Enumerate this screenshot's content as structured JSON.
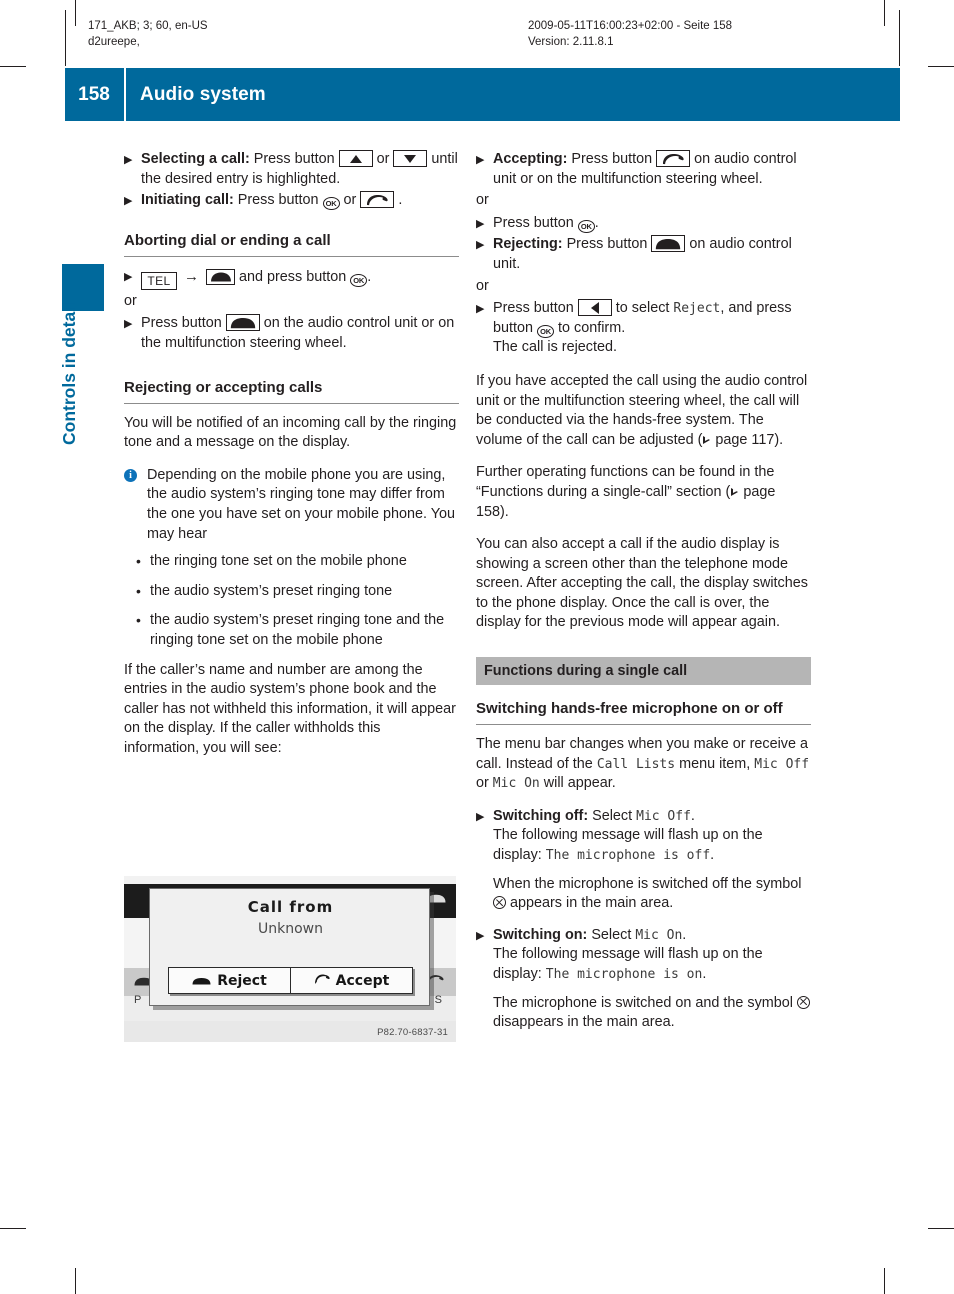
{
  "print_header": {
    "left_line1": "171_AKB; 3; 60, en-US",
    "left_line2": "d2ureepe,",
    "right_line1": "2009-05-11T16:00:23+02:00 - Seite 158",
    "right_line2": "Version: 2.11.8.1"
  },
  "banner": {
    "page_number": "158",
    "title": "Audio system",
    "color": "#00699c"
  },
  "thumb_tab": {
    "label": "Controls in detail",
    "color": "#00699c"
  },
  "left_column": {
    "step_selecting_prefix": "Selecting a call:",
    "step_selecting_text1": "Press button",
    "step_selecting_text2": "or",
    "step_selecting_text3": "until the desired entry is highlighted.",
    "step_initiating_prefix": "Initiating call:",
    "step_initiating_text1": "Press button",
    "step_initiating_text2": "or",
    "step_initiating_text3": ".",
    "heading_aborting": "Aborting dial or ending a call",
    "tel_label": "TEL",
    "step_tel_text": "and press button",
    "step_tel_period": ".",
    "or_label": "or",
    "step_press_text1": "Press button",
    "step_press_text2": "on the audio control unit or on the multifunction steering wheel.",
    "heading_rejecting": "Rejecting or accepting calls",
    "para_notified": "You will be notified of an incoming call by the ringing tone and a message on the display.",
    "note_text": "Depending on the mobile phone you are using, the audio system’s ringing tone may differ from the one you have set on your mobile phone. You may hear",
    "bullets": [
      "the ringing tone set on the mobile phone",
      "the audio system’s preset ringing tone",
      "the audio system’s preset ringing tone and the ringing tone set on the mobile phone"
    ],
    "para_caller": "If the caller’s name and number are among the entries in the audio system’s phone book and the caller has not withheld this information, it will appear on the display. If the caller withholds this information, you will see:"
  },
  "figure": {
    "dialog_title": "Call from",
    "dialog_subtitle": "Unknown",
    "button_reject": "Reject",
    "button_accept": "Accept",
    "menu_label_left": "P",
    "menu_label_right": "S",
    "caption": "P82.70-6837-31"
  },
  "right_column": {
    "step_accepting_prefix": "Accepting:",
    "step_accepting_text1": "Press button",
    "step_accepting_text2": "on audio control unit or on the multifunction steering wheel.",
    "or_label": "or",
    "step_press_ok_text1": "Press button",
    "step_press_ok_text2": ".",
    "step_rejecting_prefix": "Rejecting:",
    "step_rejecting_text1": "Press button",
    "step_rejecting_text2": "on audio control unit.",
    "step_select_text1": "Press button",
    "step_select_text2": "to select",
    "step_select_mono": "Reject",
    "step_select_text3": ", and press button",
    "step_select_text4": "to confirm.",
    "step_select_text5": "The call is rejected.",
    "para_accepted_1": "If you have accepted the call using the audio control unit or the multifunction steering wheel, the call will be conducted via the hands-free system. The volume of the call can be adjusted (",
    "para_accepted_ref": "page 117",
    "para_accepted_2": ").",
    "para_further_1": "Further operating functions can be found in the “Functions during a single-call” section (",
    "para_further_ref": "page 158",
    "para_further_2": ").",
    "para_alsoaccept": "You can also accept a call if the audio display is showing a screen other than the telephone mode screen. After accepting the call, the display switches to the phone display. Once the call is over, the display for the previous mode will appear again.",
    "grey_heading": "Functions during a single call",
    "heading_switching": "Switching hands-free microphone on or off",
    "para_menubar_1": "The menu bar changes when you make or receive a call. Instead of the",
    "para_menubar_mono1": "Call Lists",
    "para_menubar_2": "menu item,",
    "para_menubar_mono2": "Mic Off",
    "para_menubar_3": "or",
    "para_menubar_mono3": "Mic On",
    "para_menubar_4": "will appear.",
    "step_off_prefix": "Switching off:",
    "step_off_text1": "Select",
    "step_off_mono": "Mic Off",
    "step_off_text2": ".",
    "step_off_text3": "The following message will flash up on the display:",
    "step_off_mono2": "The microphone is off",
    "step_off_text4": ".",
    "step_off_text5a": "When the microphone is switched off the symbol",
    "step_off_text5b": "appears in the main area.",
    "step_on_prefix": "Switching on:",
    "step_on_text1": "Select",
    "step_on_mono": "Mic On",
    "step_on_text2": ".",
    "step_on_text3": "The following message will flash up on the display:",
    "step_on_mono2": "The microphone is on",
    "step_on_text4": ".",
    "step_on_text5a": "The microphone is switched on and the symbol",
    "step_on_text5b": "disappears in the main area."
  },
  "icons": {
    "up_arrow": "up-arrow-button",
    "down_arrow": "down-arrow-button",
    "left_arrow": "left-arrow-button",
    "ok": "OK",
    "pickup": "phone-pickup-button",
    "hangup": "phone-hangup-button",
    "mic_off": "mic-off-symbol",
    "info": "i"
  }
}
